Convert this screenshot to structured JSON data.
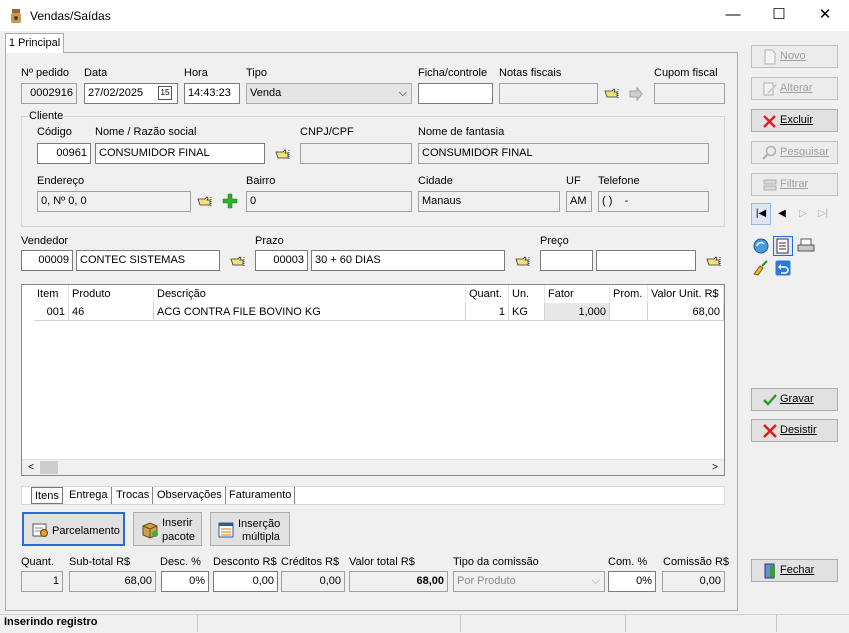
{
  "window": {
    "title": "Vendas/Saídas",
    "minimize": "—",
    "maximize": "☐",
    "close": "✕"
  },
  "tabs": {
    "main": "1 Principal"
  },
  "header": {
    "pedido_label": "Nº pedido",
    "pedido_value": "0002916",
    "data_label": "Data",
    "data_value": "27/02/2025",
    "date_btn": "15",
    "hora_label": "Hora",
    "hora_value": "14:43:23",
    "tipo_label": "Tipo",
    "tipo_value": "Venda",
    "ficha_label": "Ficha/controle",
    "ficha_value": "",
    "notas_label": "Notas fiscais",
    "notas_value": "",
    "cupom_label": "Cupom fiscal",
    "cupom_value": ""
  },
  "cliente": {
    "group_label": "Cliente",
    "codigo_label": "Código",
    "codigo_value": "00961",
    "nome_label": "Nome / Razão social",
    "nome_value": "CONSUMIDOR FINAL",
    "cnpj_label": "CNPJ/CPF",
    "cnpj_value": "",
    "fantasia_label": "Nome de fantasia",
    "fantasia_value": "CONSUMIDOR FINAL",
    "endereco_label": "Endereço",
    "endereco_value": "0, Nº 0, 0",
    "bairro_label": "Bairro",
    "bairro_value": "0",
    "cidade_label": "Cidade",
    "cidade_value": "Manaus",
    "uf_label": "UF",
    "uf_value": "AM",
    "telefone_label": "Telefone",
    "telefone_value": "( )    -"
  },
  "vendedor": {
    "label": "Vendedor",
    "code": "00009",
    "name": "CONTEC SISTEMAS"
  },
  "prazo": {
    "label": "Prazo",
    "code": "00003",
    "name": "30 + 60 DIAS"
  },
  "preco": {
    "label": "Preço",
    "code": "",
    "name": ""
  },
  "grid": {
    "headers": [
      "Item",
      "Produto",
      "Descrição",
      "Quant.",
      "Un.",
      "Fator",
      "Prom.",
      "Valor Unit. R$"
    ],
    "rows": [
      {
        "item": "001",
        "produto": "46",
        "descricao": "ACG CONTRA FILE BOVINO KG",
        "quant": "1",
        "un": "KG",
        "fator": "1,000",
        "prom": "",
        "valor": "68,00"
      }
    ]
  },
  "bottom_tabs": [
    "Itens",
    "Entrega",
    "Trocas",
    "Observações",
    "Faturamento"
  ],
  "actions": {
    "parcelamento": "Parcelamento",
    "inserir_pacote_1": "Inserir",
    "inserir_pacote_2": "pacote",
    "insercao_multipla_1": "Inserção",
    "insercao_multipla_2": "múltipla"
  },
  "totals": {
    "quant_label": "Quant.",
    "quant_value": "1",
    "subtotal_label": "Sub-total R$",
    "subtotal_value": "68,00",
    "desc_label": "Desc. %",
    "desc_value": "0%",
    "desconto_label": "Desconto R$",
    "desconto_value": "0,00",
    "creditos_label": "Créditos R$",
    "creditos_value": "0,00",
    "total_label": "Valor total R$",
    "total_value": "68,00",
    "tipo_comissao_label": "Tipo da comissão",
    "tipo_comissao_value": "Por Produto",
    "com_label": "Com. %",
    "com_value": "0%",
    "comissao_label": "Comissão R$",
    "comissao_value": "0,00"
  },
  "sidebar": {
    "novo": "Novo",
    "alterar": "Alterar",
    "excluir": "Excluir",
    "pesquisar": "Pesquisar",
    "filtrar": "Filtrar",
    "gravar": "Gravar",
    "desistir": "Desistir",
    "fechar": "Fechar"
  },
  "status": {
    "text": "Inserindo registro"
  },
  "colors": {
    "accent": "#1e5fbf",
    "disabled": "#a0a0a0",
    "delete_red": "#d92020",
    "save_green": "#2a9a2a"
  }
}
